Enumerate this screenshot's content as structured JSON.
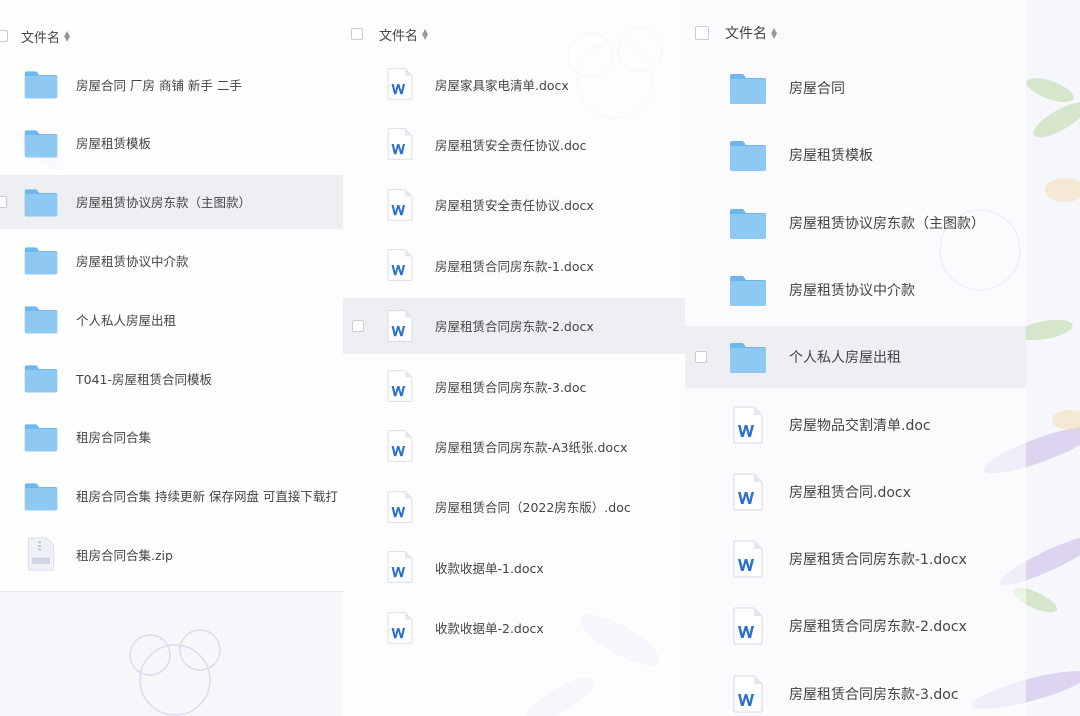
{
  "panels": [
    {
      "header_label": "文件名",
      "items": [
        {
          "name": "房屋合同  厂房 商铺  新手 二手",
          "icon": "folder-icon",
          "selected": false
        },
        {
          "name": "房屋租赁模板",
          "icon": "folder-icon",
          "selected": false
        },
        {
          "name": "房屋租赁协议房东款（主图款）",
          "icon": "folder-icon",
          "selected": true
        },
        {
          "name": "房屋租赁协议中介款",
          "icon": "folder-icon",
          "selected": false
        },
        {
          "name": "个人私人房屋出租",
          "icon": "folder-icon",
          "selected": false
        },
        {
          "name": "T041-房屋租赁合同模板",
          "icon": "folder-icon",
          "selected": false
        },
        {
          "name": "租房合同合集",
          "icon": "folder-icon",
          "selected": false
        },
        {
          "name": "租房合同合集  持续更新 保存网盘  可直接下载打",
          "icon": "folder-icon",
          "selected": false
        },
        {
          "name": "租房合同合集.zip",
          "icon": "zip-file-icon",
          "selected": false
        }
      ]
    },
    {
      "header_label": "文件名",
      "items": [
        {
          "name": "房屋家具家电清单.docx",
          "icon": "word-doc-icon",
          "selected": false
        },
        {
          "name": "房屋租赁安全责任协议.doc",
          "icon": "word-doc-icon",
          "selected": false
        },
        {
          "name": "房屋租赁安全责任协议.docx",
          "icon": "word-doc-icon",
          "selected": false
        },
        {
          "name": "房屋租赁合同房东款-1.docx",
          "icon": "word-doc-icon",
          "selected": false
        },
        {
          "name": "房屋租赁合同房东款-2.docx",
          "icon": "word-doc-icon",
          "selected": true
        },
        {
          "name": "房屋租赁合同房东款-3.doc",
          "icon": "word-doc-icon",
          "selected": false
        },
        {
          "name": "房屋租赁合同房东款-A3纸张.docx",
          "icon": "word-doc-icon",
          "selected": false
        },
        {
          "name": "房屋租赁合同（2022房东版）.doc",
          "icon": "word-doc-icon",
          "selected": false
        },
        {
          "name": "收款收据单-1.docx",
          "icon": "word-doc-icon",
          "selected": false
        },
        {
          "name": "收款收据单-2.docx",
          "icon": "word-doc-icon",
          "selected": false
        }
      ]
    },
    {
      "header_label": "文件名",
      "items": [
        {
          "name": "房屋合同",
          "icon": "folder-icon",
          "selected": false
        },
        {
          "name": "房屋租赁模板",
          "icon": "folder-icon",
          "selected": false
        },
        {
          "name": "房屋租赁协议房东款（主图款）",
          "icon": "folder-icon",
          "selected": false
        },
        {
          "name": "房屋租赁协议中介款",
          "icon": "folder-icon",
          "selected": false
        },
        {
          "name": "个人私人房屋出租",
          "icon": "folder-icon",
          "selected": true
        },
        {
          "name": "房屋物品交割清单.doc",
          "icon": "word-doc-icon",
          "selected": false
        },
        {
          "name": "房屋租赁合同.docx",
          "icon": "word-doc-icon",
          "selected": false
        },
        {
          "name": "房屋租赁合同房东款-1.docx",
          "icon": "word-doc-icon",
          "selected": false
        },
        {
          "name": "房屋租赁合同房东款-2.docx",
          "icon": "word-doc-icon",
          "selected": false
        },
        {
          "name": "房屋租赁合同房东款-3.doc",
          "icon": "word-doc-icon",
          "selected": false
        }
      ]
    }
  ],
  "colors": {
    "folder": "#8ec9f3",
    "folder_tab": "#6fb6ec",
    "word_blue": "#2b6fcf",
    "selected_row": "#eceef1"
  }
}
